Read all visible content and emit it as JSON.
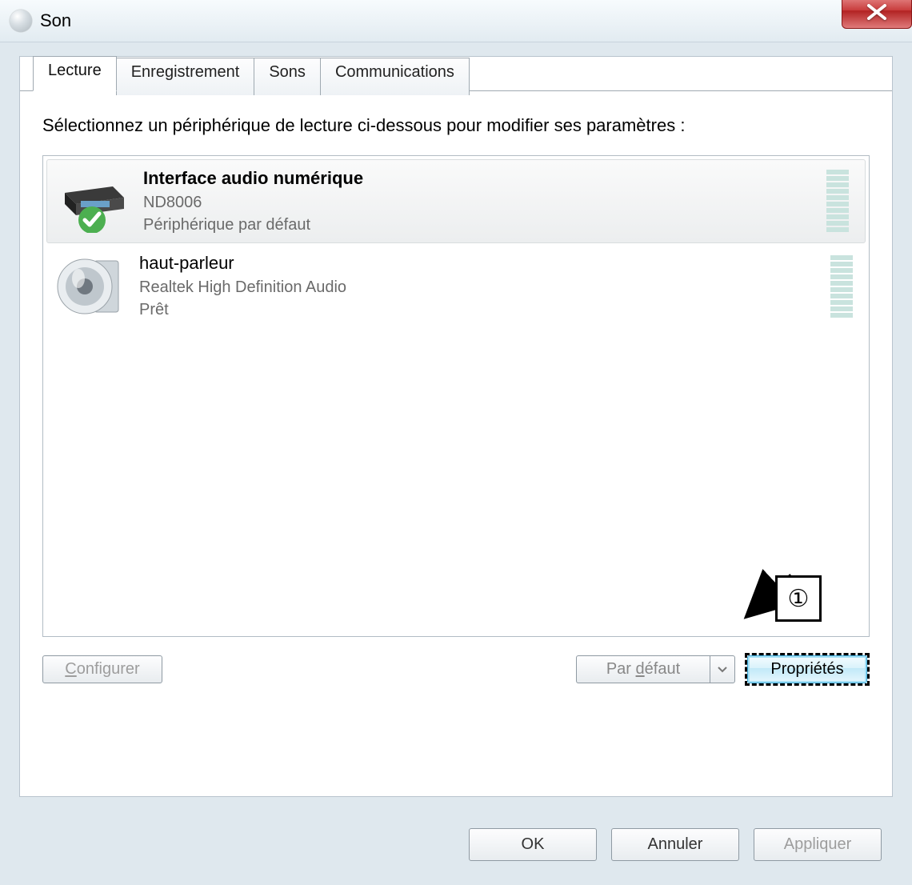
{
  "window": {
    "title": "Son"
  },
  "tabs": {
    "items": [
      "Lecture",
      "Enregistrement",
      "Sons",
      "Communications"
    ],
    "active_index": 0
  },
  "instruction": "Sélectionnez un périphérique de lecture ci-dessous pour modifier ses paramètres :",
  "devices": [
    {
      "name": "Interface audio numérique",
      "sub1": "ND8006",
      "sub2": "Périphérique par défaut",
      "default": true,
      "selected": true
    },
    {
      "name": "haut-parleur",
      "sub1": "Realtek High Definition Audio",
      "sub2": "Prêt",
      "default": false,
      "selected": false
    }
  ],
  "pane_buttons": {
    "configure": "Configurer",
    "default": "Par défaut",
    "properties": "Propriétés"
  },
  "dialog_buttons": {
    "ok": "OK",
    "cancel": "Annuler",
    "apply": "Appliquer"
  },
  "callout": {
    "label": "①"
  }
}
